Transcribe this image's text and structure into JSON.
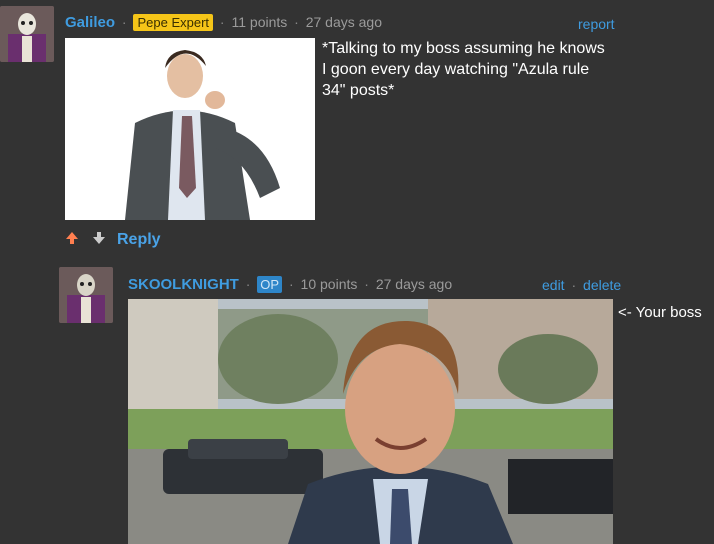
{
  "comment1": {
    "username": "Galileo",
    "flair": "Pepe Expert",
    "points": "11 points",
    "age": "27 days ago",
    "action": "report",
    "text": "*Talking to my boss assuming he knows I goon every day watching \"Azula rule 34\" posts*",
    "reply_label": "Reply"
  },
  "comment2": {
    "username": "SKOOLKNIGHT",
    "flair": "OP",
    "points": "10 points",
    "age": "27 days ago",
    "edit_label": "edit",
    "delete_label": "delete",
    "side_text": "<- Your boss"
  },
  "colors": {
    "background": "#333333",
    "username": "#3f9ce0",
    "flair_expert": "#f5c518",
    "flair_op": "#2e86c9",
    "upvote": "#ff7f50"
  }
}
